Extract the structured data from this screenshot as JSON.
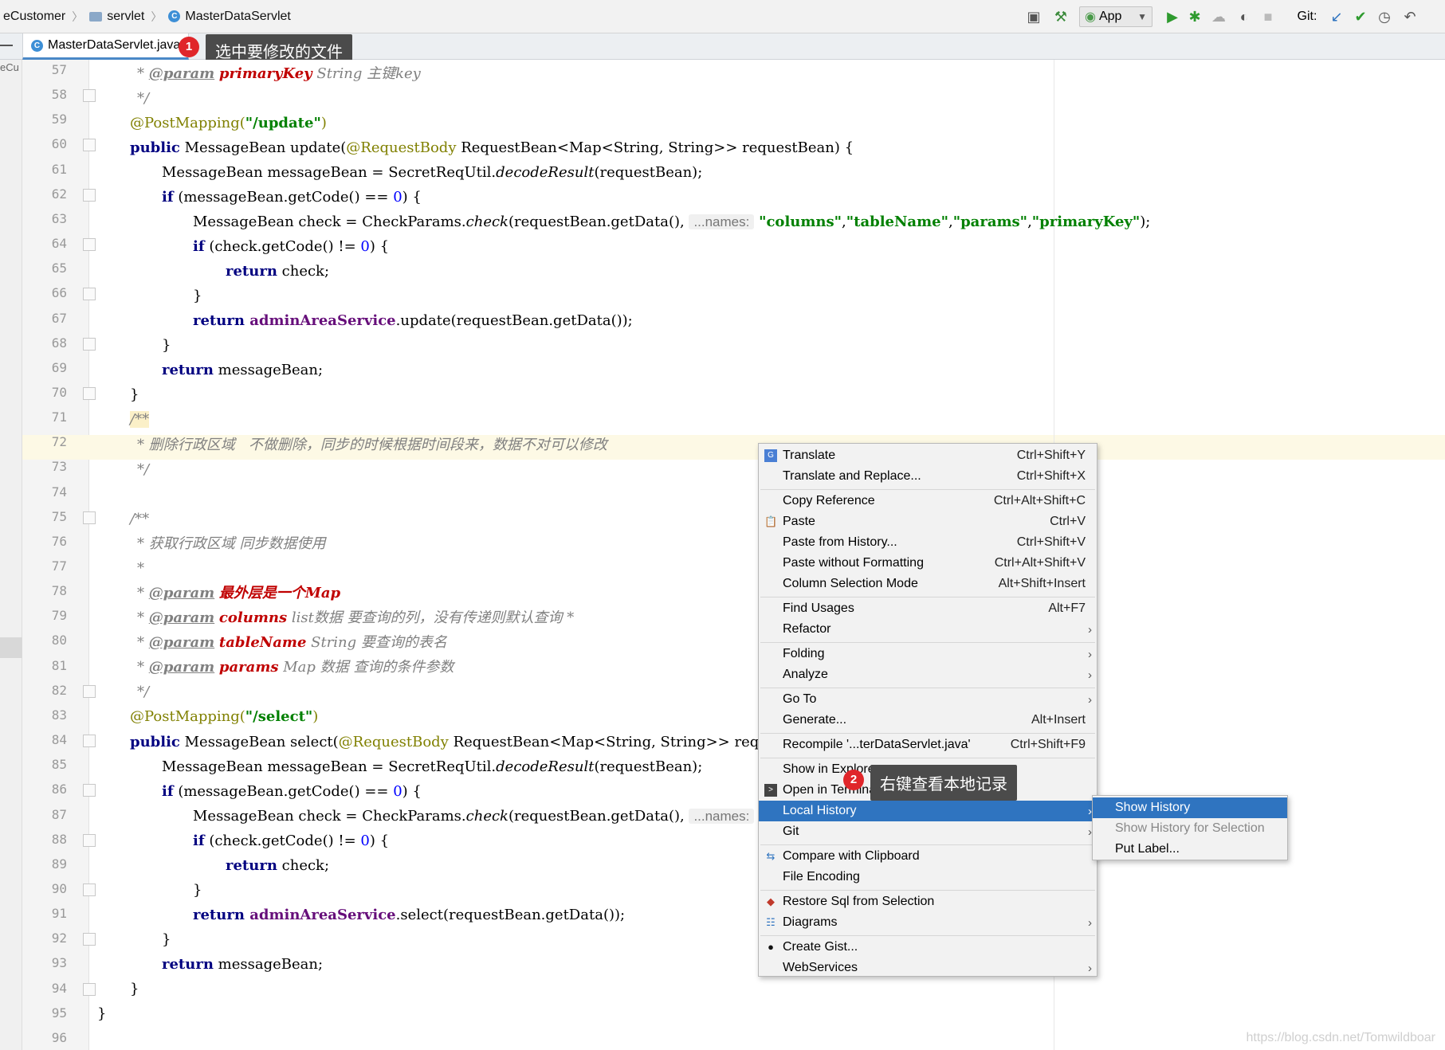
{
  "breadcrumb": {
    "project": "eCustomer",
    "folder": "servlet",
    "file": "MasterDataServlet"
  },
  "toolbar": {
    "run_config": "App",
    "git_label": "Git:"
  },
  "tab": {
    "label": "MasterDataServlet.java",
    "annotation_number": "1",
    "annotation_text": "选中要修改的文件"
  },
  "left_strip_text": "eCu",
  "line_numbers": [
    "57",
    "58",
    "59",
    "60",
    "61",
    "62",
    "63",
    "64",
    "65",
    "66",
    "67",
    "68",
    "69",
    "70",
    "71",
    "72",
    "73",
    "74",
    "75",
    "76",
    "77",
    "78",
    "79",
    "80",
    "81",
    "82",
    "83",
    "84",
    "85",
    "86",
    "87",
    "88",
    "89",
    "90",
    "91",
    "92",
    "93",
    "94",
    "95",
    "96"
  ],
  "code": {
    "l57_param": "@param",
    "l57_name": "primaryKey",
    "l57_rest": " String 主键key",
    "l58": "*/",
    "l59_an": "@PostMapping(",
    "l59_str": "\"/update\"",
    "l59_end": ")",
    "l60_kw": "public",
    "l60_a": " MessageBean update(",
    "l60_an": "@RequestBody",
    "l60_b": " RequestBean<Map<String, String>> requestBean) {",
    "l61_a": "MessageBean messageBean = SecretReqUtil.",
    "l61_it": "decodeResult",
    "l61_b": "(requestBean);",
    "l62_kw": "if",
    "l62_a": " (messageBean.getCode() == ",
    "l62_num": "0",
    "l62_b": ") {",
    "l63_a": "MessageBean check = CheckParams.",
    "l63_it": "check",
    "l63_b": "(requestBean.getData(), ",
    "l63_hint": "...names:",
    "l63_s1": "\"columns\"",
    "l63_s2": "\"tableName\"",
    "l63_s3": "\"params\"",
    "l63_s4": "\"primaryKey\"",
    "l63_end": ");",
    "l64_kw": "if",
    "l64_a": " (check.getCode() != ",
    "l64_num": "0",
    "l64_b": ") {",
    "l65_kw": "return",
    "l65_a": " check;",
    "l66": "}",
    "l67_kw": "return",
    "l67_fld": " adminAreaService",
    "l67_a": ".update(requestBean.getData());",
    "l68": "}",
    "l69_kw": "return",
    "l69_a": " messageBean;",
    "l70": "}",
    "l71": "/**",
    "l72": "* 删除行政区域   不做删除，同步的时候根据时间段来，数据不对可以修改",
    "l73": "*/",
    "l75": "/**",
    "l76": "* 获取行政区域 同步数据使用",
    "l77": "*",
    "l78_param": "@param",
    "l78_name": "最外层是一个Map",
    "l79_param": "@param",
    "l79_name": "columns",
    "l79_rest": " list数据 要查询的列，没有传递则默认查询 *",
    "l80_param": "@param",
    "l80_name": "tableName",
    "l80_rest": " String 要查询的表名",
    "l81_param": "@param",
    "l81_name": "params",
    "l81_rest": " Map 数据 查询的条件参数",
    "l82": "*/",
    "l83_an": "@PostMapping(",
    "l83_str": "\"/select\"",
    "l83_end": ")",
    "l84_kw": "public",
    "l84_a": " MessageBean select(",
    "l84_an": "@RequestBody",
    "l84_b": " RequestBean<Map<String, String>> request",
    "l85_a": "MessageBean messageBean = SecretReqUtil.",
    "l85_it": "decodeResult",
    "l85_b": "(requestBean);",
    "l86_kw": "if",
    "l86_a": " (messageBean.getCode() == ",
    "l86_num": "0",
    "l86_b": ") {",
    "l87_a": "MessageBean check = CheckParams.",
    "l87_it": "check",
    "l87_b": "(requestBean.getData(), ",
    "l87_hint": "...names:",
    "l88_kw": "if",
    "l88_a": " (check.getCode() != ",
    "l88_num": "0",
    "l88_b": ") {",
    "l89_kw": "return",
    "l89_a": " check;",
    "l90": "}",
    "l91_kw": "return",
    "l91_fld": " adminAreaService",
    "l91_a": ".select(requestBean.getData());",
    "l92": "}",
    "l93_kw": "return",
    "l93_a": " messageBean;",
    "l94": "}",
    "l95": "}"
  },
  "context_menu": {
    "translate": {
      "label": "Translate",
      "shortcut": "Ctrl+Shift+Y"
    },
    "translate_replace": {
      "label": "Translate and Replace...",
      "shortcut": "Ctrl+Shift+X"
    },
    "copy_reference": {
      "label": "Copy Reference",
      "shortcut": "Ctrl+Alt+Shift+C"
    },
    "paste": {
      "label": "Paste",
      "shortcut": "Ctrl+V"
    },
    "paste_history": {
      "label": "Paste from History...",
      "shortcut": "Ctrl+Shift+V"
    },
    "paste_without_formatting": {
      "label": "Paste without Formatting",
      "shortcut": "Ctrl+Alt+Shift+V"
    },
    "column_selection": {
      "label": "Column Selection Mode",
      "shortcut": "Alt+Shift+Insert"
    },
    "find_usages": {
      "label": "Find Usages",
      "shortcut": "Alt+F7"
    },
    "refactor": {
      "label": "Refactor"
    },
    "folding": {
      "label": "Folding"
    },
    "analyze": {
      "label": "Analyze"
    },
    "go_to": {
      "label": "Go To"
    },
    "generate": {
      "label": "Generate...",
      "shortcut": "Alt+Insert"
    },
    "recompile": {
      "label": "Recompile '...terDataServlet.java'",
      "shortcut": "Ctrl+Shift+F9"
    },
    "show_in_explorer": {
      "label": "Show in Explorer"
    },
    "open_in_terminal": {
      "label": "Open in Terminal"
    },
    "local_history": {
      "label": "Local History"
    },
    "git": {
      "label": "Git"
    },
    "compare_clipboard": {
      "label": "Compare with Clipboard"
    },
    "file_encoding": {
      "label": "File Encoding"
    },
    "restore_sql": {
      "label": "Restore Sql from Selection"
    },
    "diagrams": {
      "label": "Diagrams"
    },
    "create_gist": {
      "label": "Create Gist..."
    },
    "webservices": {
      "label": "WebServices"
    }
  },
  "submenu": {
    "show_history": "Show History",
    "show_history_selection": "Show History for Selection",
    "put_label": "Put Label..."
  },
  "annotation2": {
    "number": "2",
    "text": "右键查看本地记录"
  },
  "watermark": "https://blog.csdn.net/Tomwildboar",
  "colors": {
    "keyword": "#000080",
    "annotation": "#808000",
    "string": "#008000",
    "number": "#0000ff",
    "comment": "#808080",
    "param_name": "#c00000",
    "field": "#660e7a",
    "menu_selected": "#2f74c0"
  }
}
